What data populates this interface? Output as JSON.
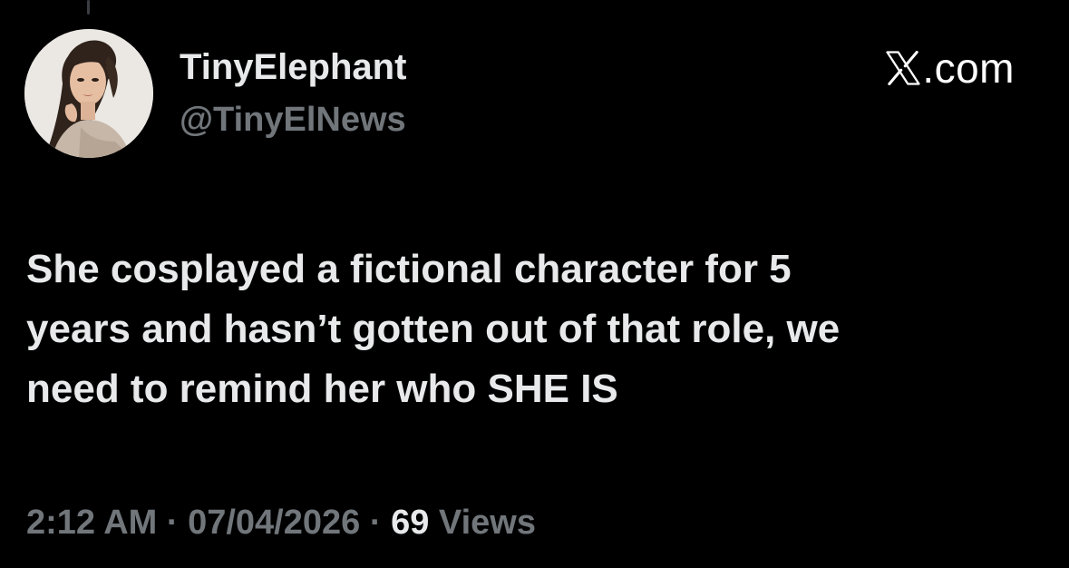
{
  "author": {
    "display_name": "TinyElephant",
    "handle": "@TinyElNews"
  },
  "brand": {
    "domain": ".com",
    "icon": "x-logo-icon"
  },
  "tweet": {
    "text": "She cosplayed a fictional character for 5\nyears and hasn’t gotten out of that role, we\nneed to remind her who SHE IS"
  },
  "meta": {
    "time": "2:12 AM",
    "separator": "·",
    "date": "07/04/2026",
    "views_count": "69",
    "views_label": "Views"
  },
  "colors": {
    "background": "#000000",
    "primary_text": "#e7e9ea",
    "secondary_text": "#71767b"
  }
}
